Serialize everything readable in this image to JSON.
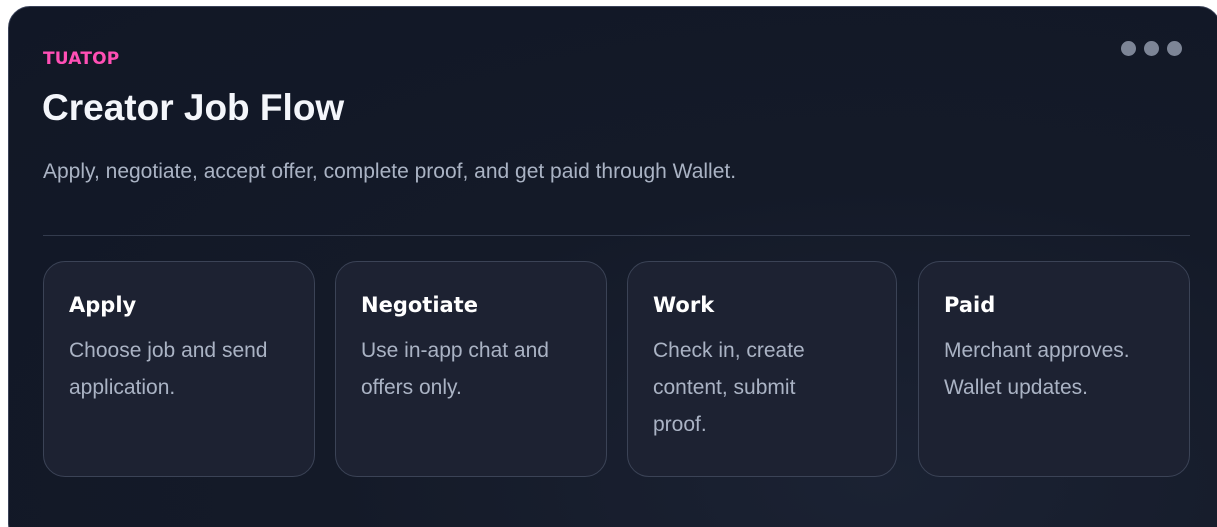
{
  "brand": "TUATOP",
  "title": "Creator Job Flow",
  "subtitle": "Apply, negotiate, accept offer, complete proof, and get paid through Wallet.",
  "menu_icon": "more-horizontal-icon",
  "steps": [
    {
      "title": "Apply",
      "text": "Choose job and send application."
    },
    {
      "title": "Negotiate",
      "text": "Use in-app chat and offers only."
    },
    {
      "title": "Work",
      "text": "Check in, create content, submit proof."
    },
    {
      "title": "Paid",
      "text": "Merchant approves. Wallet updates."
    }
  ],
  "colors": {
    "brand": "#ff4fb5",
    "background": "#121827",
    "card": "#1d2232",
    "text_primary": "#f4f6fb",
    "text_secondary": "#aab3c4"
  }
}
